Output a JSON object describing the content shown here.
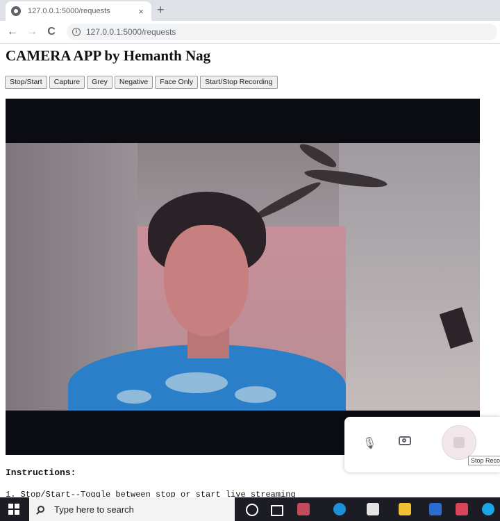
{
  "browser": {
    "tab_title": "127.0.0.1:5000/requests",
    "tab_close": "×",
    "new_tab": "+",
    "back": "←",
    "forward": "→",
    "reload": "C",
    "info": "i",
    "url": "127.0.0.1:5000/requests"
  },
  "page": {
    "title": "CAMERA APP by Hemanth Nag",
    "buttons": [
      "Stop/Start",
      "Capture",
      "Grey",
      "Negative",
      "Face Only",
      "Start/Stop Recording"
    ],
    "instructions_heading": "Instructions:",
    "instruction_1": "1.  Stop/Start--Toggle between stop or start live streaming"
  },
  "meeting_bar": {
    "mic": "🎙",
    "tooltip": "Stop Reco"
  },
  "taskbar": {
    "search_placeholder": "Type here to search"
  },
  "colors": {
    "video_bg": "#0b0c12",
    "taskbar": "#1b1c24",
    "tabstrip": "#dee1e6"
  }
}
